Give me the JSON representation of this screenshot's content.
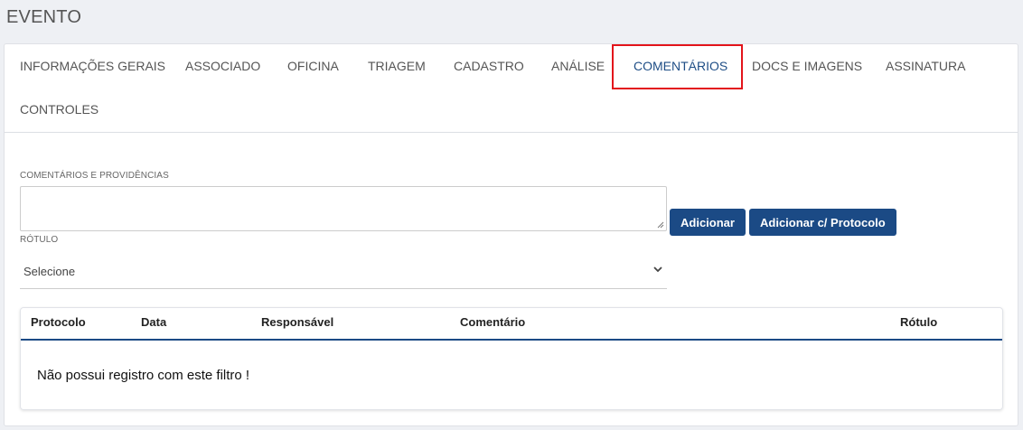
{
  "page": {
    "title": "EVENTO"
  },
  "tabs": [
    {
      "label": "INFORMAÇÕES GERAIS"
    },
    {
      "label": "ASSOCIADO"
    },
    {
      "label": "OFICINA"
    },
    {
      "label": "TRIAGEM"
    },
    {
      "label": "CADASTRO"
    },
    {
      "label": "ANÁLISE"
    },
    {
      "label": "COMENTÁRIOS",
      "active": true
    },
    {
      "label": "DOCS E IMAGENS"
    },
    {
      "label": "ASSINATURA"
    },
    {
      "label": "CONTROLES"
    }
  ],
  "form": {
    "comments_label": "COMENTÁRIOS E PROVIDÊNCIAS",
    "comments_value": "",
    "rotulo_label": "RÓTULO",
    "rotulo_selected": "Selecione",
    "add_button": "Adicionar",
    "add_protocol_button": "Adicionar c/ Protocolo"
  },
  "table": {
    "columns": [
      "Protocolo",
      "Data",
      "Responsável",
      "Comentário",
      "Rótulo"
    ],
    "empty_message": "Não possui registro com este filtro !"
  },
  "colors": {
    "accent": "#1b4a85",
    "highlight": "#e3141b"
  }
}
